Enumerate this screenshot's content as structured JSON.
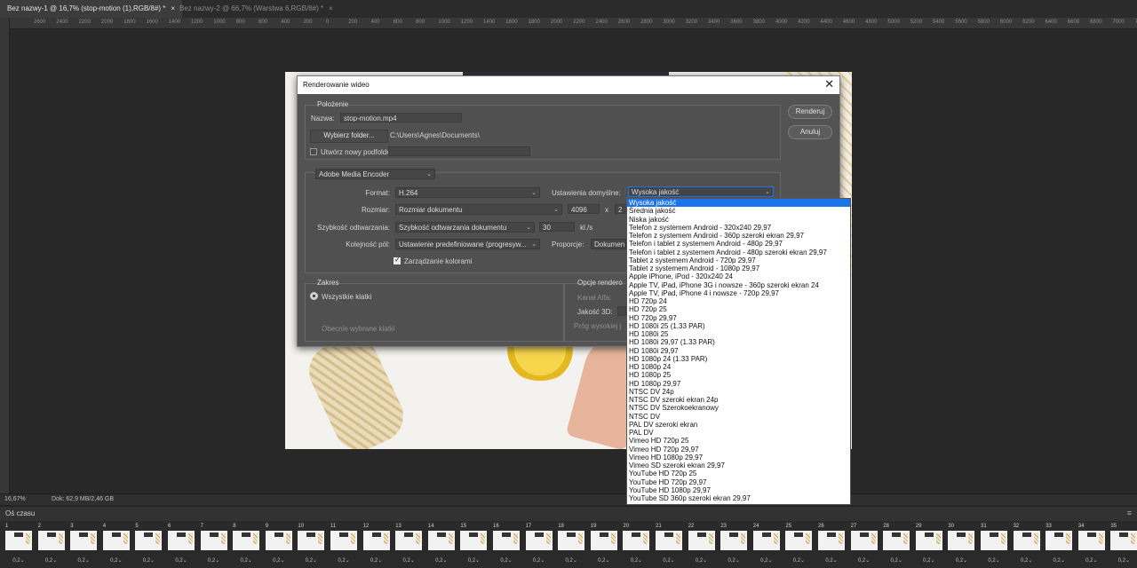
{
  "tabs": [
    {
      "label": "Bez nazwy-1 @ 16,7% (stop-motion (1),RGB/8#) *",
      "close": "×"
    },
    {
      "label": "Bez nazwy-2 @ 66,7% (Warstwa 6,RGB/8#) *",
      "close": "×"
    }
  ],
  "ruler_ticks": [
    "2600",
    "2400",
    "2200",
    "2000",
    "1800",
    "1600",
    "1400",
    "1200",
    "1000",
    "800",
    "600",
    "400",
    "200",
    "0",
    "200",
    "400",
    "600",
    "800",
    "1000",
    "1200",
    "1400",
    "1600",
    "1800",
    "2000",
    "2200",
    "2400",
    "2600",
    "2800",
    "3000",
    "3200",
    "3400",
    "3600",
    "3800",
    "4000",
    "4200",
    "4400",
    "4600",
    "4800",
    "5000",
    "5200",
    "5400",
    "5600",
    "5800",
    "6000",
    "6200",
    "6400",
    "6600",
    "6800",
    "7000",
    "7200"
  ],
  "status": {
    "zoom": "16,67%",
    "doc": "Dok: 62,9 MB/2,46 GB"
  },
  "timeline": {
    "title": "Oś czasu",
    "menu": "≡",
    "delay": "0,2",
    "frames": [
      "1",
      "2",
      "3",
      "4",
      "5",
      "6",
      "7",
      "8",
      "9",
      "10",
      "11",
      "12",
      "13",
      "14",
      "15",
      "16",
      "17",
      "18",
      "19",
      "20",
      "21",
      "22",
      "23",
      "24",
      "25",
      "26",
      "27",
      "28",
      "29",
      "30",
      "31",
      "32",
      "33",
      "34",
      "35"
    ]
  },
  "dialog": {
    "title": "Renderowanie wideo",
    "close": "✕",
    "render_button": "Renderuj",
    "cancel_button": "Anuluj",
    "location": {
      "group_label": "Położenie",
      "name_label": "Nazwa:",
      "name_value": "stop-motion.mp4",
      "choose_folder": "Wybierz folder...",
      "folder_path": "C:\\Users\\Agnes\\Documents\\",
      "new_subfolder_label": "Utwórz nowy podfolder:",
      "new_subfolder_checked": false
    },
    "encoder": {
      "selected": "Adobe Media Encoder",
      "format_label": "Format:",
      "format_value": "H.264",
      "preset_label": "Ustawienia domyślne:",
      "preset_value": "Wysoka jakość",
      "size_label": "Rozmiar:",
      "size_value": "Rozmiar dokumentu",
      "width": "4096",
      "x": "x",
      "height": "2",
      "framerate_label": "Szybkość odtwarzania:",
      "framerate_value": "Szybkość odtwarzania dokumentu",
      "fps": "30",
      "fps_unit": "kl./s",
      "field_order_label": "Kolejność pól:",
      "field_order_value": "Ustawienie predefiniowane (progresyw...",
      "aspect_label": "Proporcje:",
      "aspect_value": "Dokumen",
      "color_mgmt_label": "Zarządzanie kolorami",
      "color_mgmt_checked": true
    },
    "range": {
      "group_label": "Zakres",
      "all_frames": "Wszystkie klatki",
      "selected_frames": "Obecnie wybrane klatki"
    },
    "render_options": {
      "group_label": "Opcje rendero",
      "alpha_label": "Kanał Alfa:",
      "3d_label": "Jakość 3D:",
      "threshold_label": "Próg wysokiej j"
    }
  },
  "preset_options": [
    "Wysoka jakość",
    "Średnia jakość",
    "Niska jakość",
    "Telefon z systemem Android - 320x240 29,97",
    "Telefon z systemem Android - 360p szeroki ekran 29,97",
    "Telefon i tablet z systemem Android - 480p 29,97",
    "Telefon i tablet z systemem Android - 480p szeroki ekran 29,97",
    "Tablet z systemem Android - 720p 29,97",
    "Tablet z systemem Android - 1080p 29,97",
    "Apple iPhone, iPod - 320x240 24",
    "Apple TV, iPad, iPhone 3G i nowsze - 360p szeroki ekran 24",
    "Apple TV, iPad, iPhone 4 i nowsze - 720p 29,97",
    "HD 720p 24",
    "HD 720p 25",
    "HD 720p 29,97",
    "HD 1080i 25 (1.33 PAR)",
    "HD 1080i 25",
    "HD 1080i 29,97 (1.33 PAR)",
    "HD 1080i 29,97",
    "HD 1080p 24 (1.33 PAR)",
    "HD 1080p 24",
    "HD 1080p 25",
    "HD 1080p 29,97",
    "NTSC DV 24p",
    "NTSC DV szeroki ekran 24p",
    "NTSC DV Szerokoekranowy",
    "NTSC DV",
    "PAL DV szeroki ekran",
    "PAL DV",
    "Vimeo HD 720p 25",
    "Vimeo HD 720p 29,97",
    "Vimeo HD 1080p 29,97",
    "Vimeo SD szeroki ekran 29,97",
    "YouTube HD 720p 25",
    "YouTube HD 720p 29,97",
    "YouTube HD 1080p 29,97",
    "YouTube SD 360p szeroki ekran 29,97"
  ],
  "colors": {
    "accent": "#1a73e8",
    "dialog_bg": "#535353",
    "app_bg": "#282828"
  }
}
